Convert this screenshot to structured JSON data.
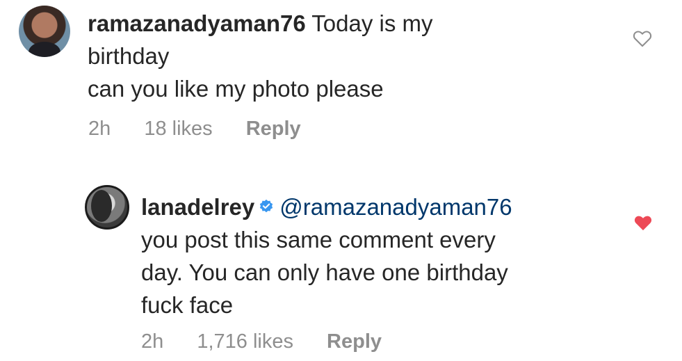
{
  "comments": [
    {
      "username": "ramazanadyaman76",
      "text_lines": [
        "Today is my",
        "birthday",
        "can you like my photo please"
      ],
      "time": "2h",
      "likes": "18 likes",
      "reply_label": "Reply",
      "liked": false,
      "verified": false
    },
    {
      "username": "lanadelrey",
      "mention": "@ramazanadyaman76",
      "text_lines": [
        "you post this same comment every",
        "day. You can only have one birthday",
        "fuck face"
      ],
      "time": "2h",
      "likes": "1,716 likes",
      "reply_label": "Reply",
      "liked": true,
      "verified": true
    }
  ],
  "colors": {
    "text": "#262626",
    "meta": "#8e8e8e",
    "mention": "#00376b",
    "verified": "#3897f0",
    "heart_liked": "#ed4956",
    "heart_outline": "#8e8e8e"
  },
  "icons": {
    "verified": "verified-badge-icon",
    "like_outline": "heart-outline-icon",
    "like_filled": "heart-filled-icon"
  }
}
